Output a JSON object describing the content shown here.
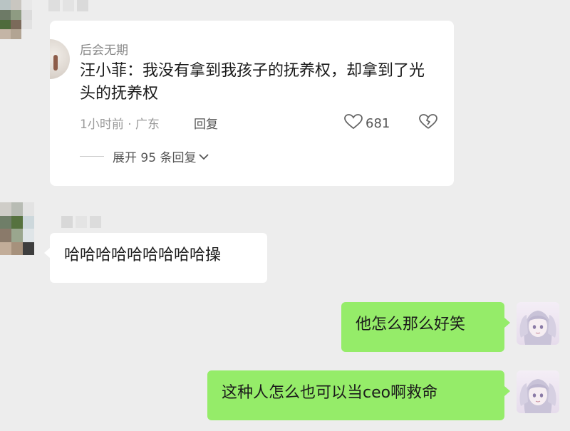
{
  "comment_card": {
    "username": "后会无期",
    "text": "汪小菲：我没有拿到我孩子的抚养权，却拿到了光头的抚养权",
    "meta": "1小时前 · 广东",
    "reply_label": "回复",
    "like_count": "681",
    "expand_label": "展开 95 条回复"
  },
  "messages": [
    {
      "side": "left",
      "text": "哈哈哈哈哈哈哈哈哈操"
    },
    {
      "side": "right",
      "text": "他怎么那么好笑"
    },
    {
      "side": "right",
      "text": "这种人怎么也可以当ceo啊救命"
    }
  ],
  "colors": {
    "background": "#ededed",
    "sent_bubble": "#95ec69",
    "received_bubble": "#ffffff"
  },
  "icons": [
    "heart-icon",
    "broken-heart-icon",
    "chevron-down-icon"
  ]
}
